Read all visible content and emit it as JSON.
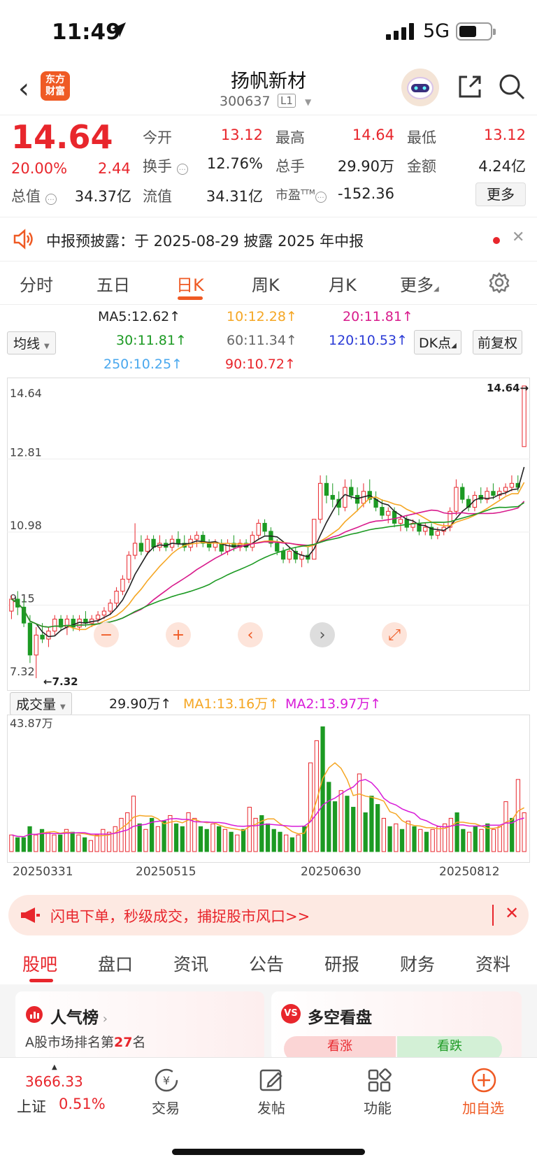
{
  "status_bar": {
    "time": "11:49",
    "network": "5G"
  },
  "header": {
    "logo": "东方\n财富",
    "title": "扬帆新材",
    "code": "300637",
    "level": "L1"
  },
  "quote": {
    "price": "14.64",
    "pct": "20.00%",
    "change": "2.44",
    "fields": [
      {
        "label": "今开",
        "value": "13.12",
        "color": "red"
      },
      {
        "label": "最高",
        "value": "14.64",
        "color": "red"
      },
      {
        "label": "最低",
        "value": "13.12",
        "color": "red"
      },
      {
        "label": "换手",
        "value": "12.76%",
        "color": "black"
      },
      {
        "label": "总手",
        "value": "29.90万",
        "color": "black"
      },
      {
        "label": "金额",
        "value": "4.24亿",
        "color": "black"
      },
      {
        "label": "总值",
        "value": "34.37亿",
        "color": "black"
      },
      {
        "label": "流值",
        "value": "34.31亿",
        "color": "black"
      },
      {
        "label": "市盈",
        "value": "-152.36",
        "color": "black"
      }
    ],
    "ttm": "TTM",
    "more": "更多"
  },
  "notice": {
    "text": "中报预披露：于 2025-08-29 披露 2025 年中报"
  },
  "ktabs": [
    "分时",
    "五日",
    "日K",
    "周K",
    "月K",
    "更多"
  ],
  "ma_bar": {
    "selector": "均线",
    "items": [
      {
        "text": "MA5:12.62",
        "color": "#222222"
      },
      {
        "text": "10:12.28",
        "color": "#f5a623"
      },
      {
        "text": "20:11.81",
        "color": "#d81b8c"
      },
      {
        "text": "30:11.81",
        "color": "#1c9a23"
      },
      {
        "text": "60:11.34",
        "color": "#666666"
      },
      {
        "text": "120:10.53",
        "color": "#2b3bd6"
      },
      {
        "text": "250:10.25",
        "color": "#4aa8ee"
      },
      {
        "text": "90:10.72",
        "color": "#e8262c"
      }
    ],
    "arrow": "↑",
    "dk": "DK点",
    "adjust": "前复权"
  },
  "chart_data": [
    {
      "type": "candlestick",
      "ylim": [
        7.32,
        14.64
      ],
      "y_ticks": [
        "14.64",
        "12.81",
        "10.98",
        "9.15",
        "7.32"
      ],
      "high_label": "14.64",
      "low_label": "7.32",
      "x_labels": [
        "20250331",
        "20250515",
        "20250630",
        "20250812"
      ],
      "candles": [
        [
          9.0,
          9.4,
          8.8,
          9.3
        ],
        [
          9.3,
          9.5,
          8.9,
          9.1
        ],
        [
          9.1,
          9.3,
          8.6,
          8.7
        ],
        [
          8.7,
          8.9,
          7.7,
          7.9
        ],
        [
          7.9,
          8.6,
          7.32,
          8.4
        ],
        [
          8.4,
          8.7,
          8.2,
          8.3
        ],
        [
          8.3,
          8.6,
          8.1,
          8.5
        ],
        [
          8.5,
          8.9,
          8.4,
          8.8
        ],
        [
          8.8,
          8.9,
          8.5,
          8.6
        ],
        [
          8.6,
          8.9,
          8.4,
          8.8
        ],
        [
          8.8,
          8.9,
          8.5,
          8.6
        ],
        [
          8.6,
          8.9,
          8.5,
          8.8
        ],
        [
          8.8,
          9.0,
          8.6,
          8.7
        ],
        [
          8.7,
          8.9,
          8.6,
          8.8
        ],
        [
          8.8,
          9.0,
          8.7,
          8.9
        ],
        [
          8.9,
          9.1,
          8.8,
          9.0
        ],
        [
          9.0,
          9.3,
          8.9,
          9.2
        ],
        [
          9.2,
          9.6,
          9.1,
          9.5
        ],
        [
          9.5,
          9.9,
          9.4,
          9.8
        ],
        [
          9.8,
          10.5,
          9.7,
          10.4
        ],
        [
          10.4,
          11.2,
          10.3,
          10.7
        ],
        [
          10.7,
          10.9,
          10.4,
          10.5
        ],
        [
          10.5,
          10.9,
          10.4,
          10.8
        ],
        [
          10.8,
          10.9,
          10.5,
          10.6
        ],
        [
          10.6,
          10.9,
          10.5,
          10.7
        ],
        [
          10.7,
          10.8,
          10.5,
          10.6
        ],
        [
          10.6,
          10.9,
          10.5,
          10.8
        ],
        [
          10.8,
          11.0,
          10.6,
          10.7
        ],
        [
          10.7,
          10.9,
          10.5,
          10.6
        ],
        [
          10.6,
          10.9,
          10.5,
          10.8
        ],
        [
          10.8,
          11.0,
          10.6,
          10.9
        ],
        [
          10.9,
          11.0,
          10.6,
          10.7
        ],
        [
          10.7,
          10.8,
          10.5,
          10.6
        ],
        [
          10.6,
          10.8,
          10.5,
          10.7
        ],
        [
          10.7,
          10.8,
          10.4,
          10.5
        ],
        [
          10.5,
          10.8,
          10.4,
          10.7
        ],
        [
          10.7,
          10.9,
          10.5,
          10.6
        ],
        [
          10.6,
          10.8,
          10.5,
          10.7
        ],
        [
          10.7,
          10.8,
          10.5,
          10.6
        ],
        [
          10.6,
          11.0,
          10.5,
          10.9
        ],
        [
          10.9,
          11.3,
          10.8,
          11.2
        ],
        [
          11.2,
          11.3,
          10.9,
          11.0
        ],
        [
          11.0,
          11.1,
          10.6,
          10.7
        ],
        [
          10.7,
          10.8,
          10.4,
          10.5
        ],
        [
          10.5,
          10.6,
          10.2,
          10.3
        ],
        [
          10.3,
          10.6,
          10.2,
          10.5
        ],
        [
          10.5,
          10.6,
          10.2,
          10.3
        ],
        [
          10.3,
          10.5,
          10.1,
          10.4
        ],
        [
          10.4,
          10.6,
          10.2,
          10.3
        ],
        [
          10.3,
          11.3,
          10.3,
          11.3
        ],
        [
          11.3,
          12.4,
          11.2,
          12.2
        ],
        [
          12.2,
          12.4,
          11.7,
          11.9
        ],
        [
          11.9,
          12.2,
          11.6,
          11.8
        ],
        [
          11.8,
          12.0,
          11.4,
          11.6
        ],
        [
          11.6,
          12.3,
          11.5,
          12.1
        ],
        [
          12.1,
          12.3,
          11.8,
          11.9
        ],
        [
          11.9,
          12.1,
          11.5,
          11.7
        ],
        [
          11.7,
          12.2,
          11.6,
          12.0
        ],
        [
          12.0,
          12.3,
          11.7,
          11.8
        ],
        [
          11.8,
          12.0,
          11.5,
          11.6
        ],
        [
          11.6,
          11.8,
          11.3,
          11.4
        ],
        [
          11.4,
          11.6,
          11.2,
          11.5
        ],
        [
          11.5,
          11.6,
          11.1,
          11.2
        ],
        [
          11.2,
          11.4,
          11.0,
          11.3
        ],
        [
          11.3,
          11.4,
          11.0,
          11.1
        ],
        [
          11.1,
          11.3,
          11.0,
          11.2
        ],
        [
          11.2,
          11.3,
          10.9,
          11.0
        ],
        [
          11.0,
          11.2,
          10.9,
          11.1
        ],
        [
          11.1,
          11.2,
          10.8,
          10.9
        ],
        [
          10.9,
          11.1,
          10.8,
          11.0
        ],
        [
          11.0,
          11.2,
          10.9,
          11.1
        ],
        [
          11.1,
          11.6,
          11.0,
          11.5
        ],
        [
          11.5,
          12.3,
          11.4,
          12.1
        ],
        [
          12.1,
          12.2,
          11.7,
          11.8
        ],
        [
          11.8,
          11.9,
          11.5,
          11.6
        ],
        [
          11.6,
          12.0,
          11.5,
          11.9
        ],
        [
          11.9,
          12.1,
          11.7,
          11.8
        ],
        [
          11.8,
          12.1,
          11.7,
          12.0
        ],
        [
          12.0,
          12.2,
          11.8,
          11.9
        ],
        [
          11.9,
          12.1,
          11.8,
          12.0
        ],
        [
          12.0,
          12.2,
          11.9,
          12.1
        ],
        [
          12.1,
          12.4,
          12.0,
          12.2
        ],
        [
          12.2,
          12.4,
          12.0,
          12.1
        ],
        [
          13.12,
          14.64,
          13.12,
          14.64
        ]
      ]
    },
    {
      "type": "bar",
      "name": "成交量",
      "ylim": [
        0,
        43.87
      ],
      "top_label": "43.87万",
      "values": [
        6,
        5,
        5,
        9,
        6,
        8,
        7,
        6,
        6,
        8,
        7,
        6,
        5,
        4,
        6,
        8,
        7,
        9,
        12,
        14,
        20,
        10,
        8,
        12,
        9,
        11,
        13,
        10,
        9,
        14,
        12,
        9,
        8,
        10,
        9,
        8,
        7,
        6,
        8,
        16,
        12,
        13,
        10,
        8,
        7,
        6,
        5,
        6,
        9,
        32,
        40,
        45,
        25,
        18,
        22,
        20,
        16,
        28,
        14,
        20,
        17,
        12,
        9,
        10,
        8,
        11,
        9,
        8,
        7,
        8,
        9,
        10,
        12,
        14,
        8,
        7,
        9,
        8,
        10,
        8,
        9,
        18,
        12,
        26,
        14
      ]
    }
  ],
  "volume_bar": {
    "selector": "成交量",
    "vol": "29.90万",
    "ma1": "MA1:13.16万",
    "ma2": "MA2:13.97万"
  },
  "banner": {
    "text": "闪电下单，秒级成交，捕捉股市风口>>"
  },
  "bottom_tabs": [
    "股吧",
    "盘口",
    "资讯",
    "公告",
    "研报",
    "财务",
    "资料"
  ],
  "cards": {
    "left": {
      "title": "人气榜",
      "subtitle_a": "A股市场排名第",
      "rank": "27",
      "subtitle_b": "名"
    },
    "right": {
      "title": "多空看盘",
      "up": "看涨",
      "down": "看跌"
    }
  },
  "tabbar": {
    "index_value": "3666.33",
    "index_name": "上证",
    "index_pct": "0.51%",
    "items": [
      "交易",
      "发帖",
      "功能",
      "加自选"
    ]
  }
}
